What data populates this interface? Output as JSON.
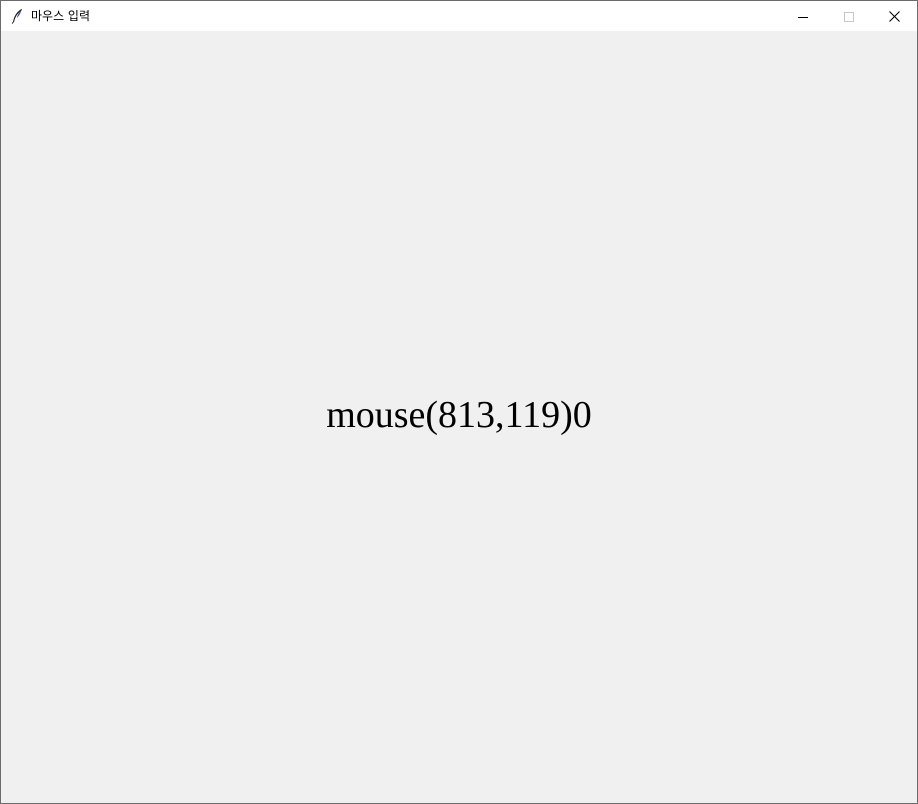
{
  "window": {
    "title": "마우스 입력",
    "app_icon": "feather-icon",
    "controls": {
      "minimize_icon": "minimize-icon",
      "maximize_icon": "maximize-icon",
      "close_icon": "close-icon"
    }
  },
  "canvas": {
    "text": "mouse(813,119)0",
    "background": "#f0f0f0",
    "text_color": "#000000"
  }
}
